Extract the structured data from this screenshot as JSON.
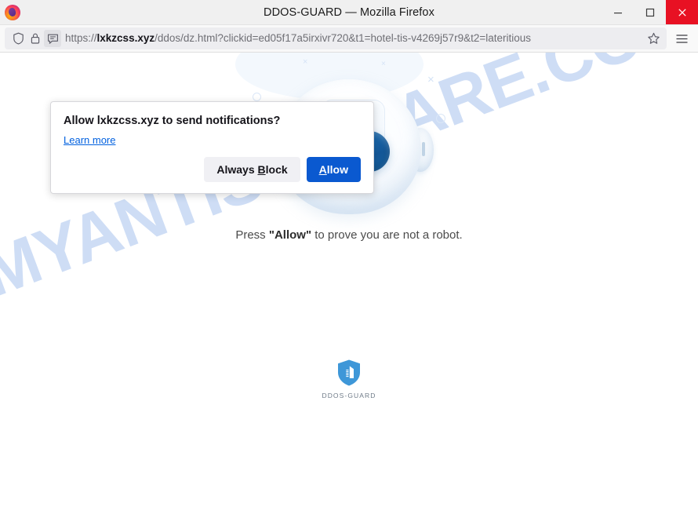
{
  "window": {
    "title": "DDOS-GUARD — Mozilla Firefox",
    "firefox_logo_icon": "firefox-logo",
    "controls": {
      "minimize_icon": "minimize-icon",
      "maximize_icon": "maximize-icon",
      "close_icon": "close-icon",
      "close_bg": "#e81123"
    }
  },
  "toolbar": {
    "shield_icon": "shield-icon",
    "lock_icon": "padlock-icon",
    "permission_icon": "notification-permission-icon",
    "bookmark_icon": "star-icon",
    "menu_icon": "hamburger-menu-icon",
    "url": {
      "scheme": "https://",
      "host": "lxkzcss.xyz",
      "path": "/ddos/dz.html?clickid=ed05f17a5irxivr720&t1=hotel-tis-v4269j57r9&t2=lateritious",
      "full": "https://lxkzcss.xyz/ddos/dz.html?clickid=ed05f17a5irxivr720&t1=hotel-tis-v4269j57r9&t2=lateritious"
    }
  },
  "permission_popup": {
    "title": "Allow lxkzcss.xyz to send notifications?",
    "learn_more": "Learn more",
    "block_button": {
      "prefix": "Always ",
      "accesskey": "B",
      "suffix": "lock"
    },
    "allow_button": {
      "accesskey": "A",
      "suffix": "llow"
    },
    "primary_color": "#0a59d0"
  },
  "page": {
    "watermark": "MYANTISPYWARE.COM",
    "watermark_color": "#ccdcf5",
    "robot_icon": "robot-mascot-icon",
    "prompt": {
      "prefix": "Press ",
      "emphasis": "\"Allow\"",
      "suffix": " to prove you are not a robot."
    },
    "footer_logo": {
      "shield_icon": "ddos-guard-shield-icon",
      "label": "DDOS-GUARD",
      "color": "#3e97d8"
    }
  }
}
